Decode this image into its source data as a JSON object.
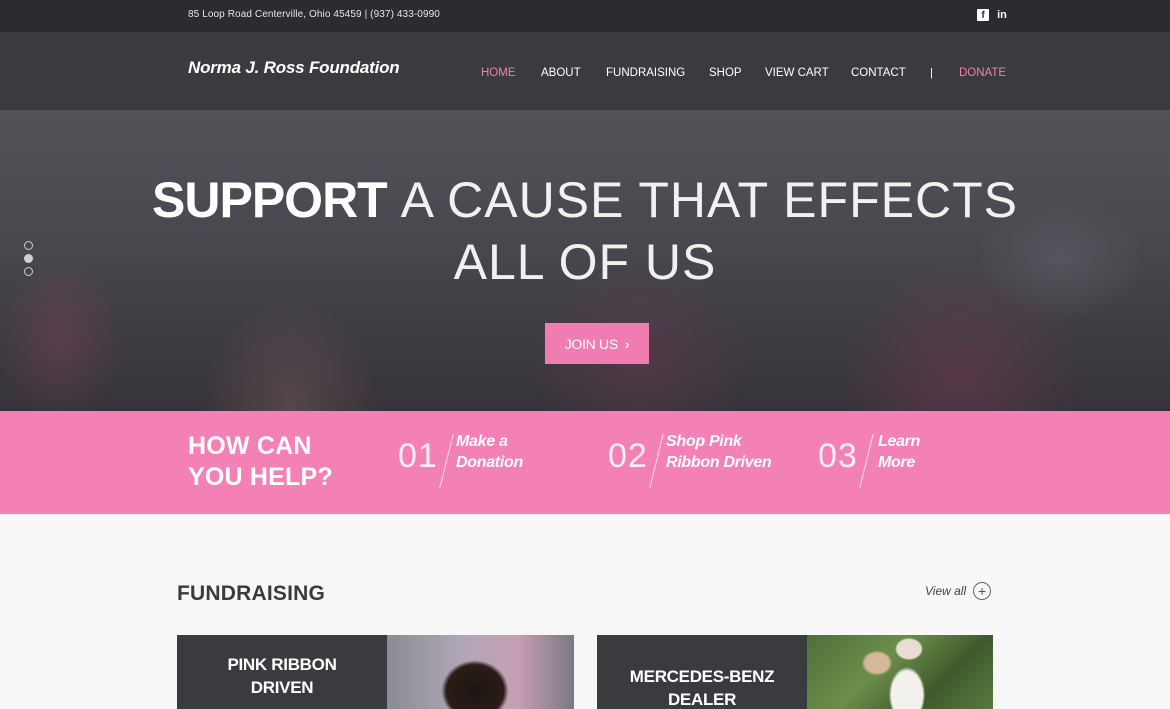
{
  "topbar": {
    "address": "85 Loop Road Centerville, Ohio 45459 | (937) 433-0990",
    "social": [
      {
        "icon": "facebook-icon",
        "glyph": "f"
      },
      {
        "icon": "linkedin-icon",
        "glyph": "in"
      }
    ]
  },
  "header": {
    "logo": "Norma J. Ross Foundation",
    "nav": [
      {
        "label": "HOME",
        "active": true
      },
      {
        "label": "ABOUT",
        "active": false
      },
      {
        "label": "FUNDRAISING",
        "active": false
      },
      {
        "label": "SHOP",
        "active": false
      },
      {
        "label": "VIEW CART",
        "active": false
      },
      {
        "label": "CONTACT",
        "active": false
      }
    ],
    "separator": "|",
    "donate": "DONATE",
    "accent_color": "#f27fb2"
  },
  "hero": {
    "headline_bold": "SUPPORT",
    "headline_rest": "A CAUSE THAT EFFECTS",
    "headline_line2": "ALL OF US",
    "cta": "JOIN US",
    "cta_icon": "chevron-right-icon",
    "slides_total": 3,
    "active_slide": 2
  },
  "help": {
    "title_line1": "HOW CAN",
    "title_line2": "YOU HELP?",
    "steps": [
      {
        "num": "01",
        "line1": "Make a",
        "line2": "Donation"
      },
      {
        "num": "02",
        "line1": "Shop Pink",
        "line2": "Ribbon Driven"
      },
      {
        "num": "03",
        "line1": "Learn",
        "line2": "More"
      }
    ],
    "band_color": "#f381b5"
  },
  "fundraising": {
    "title": "FUNDRAISING",
    "view_all": "View all",
    "view_all_icon": "plus-circle-icon",
    "cards": [
      {
        "line1": "PINK RIBBON",
        "line2": "DRIVEN"
      },
      {
        "line1": "MERCEDES-BENZ",
        "line2": "DEALER"
      }
    ]
  }
}
